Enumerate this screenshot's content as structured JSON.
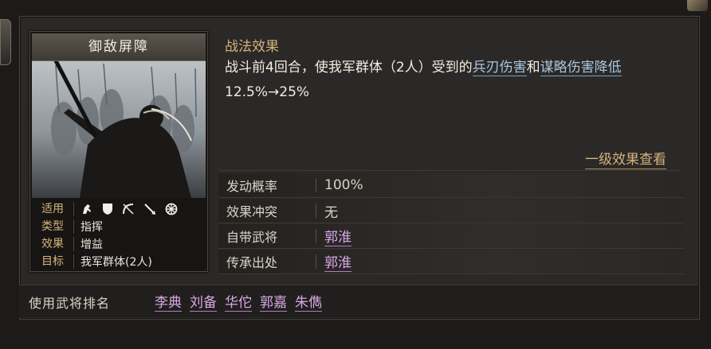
{
  "card": {
    "title": "御敌屏障",
    "info": [
      {
        "key": "适用",
        "value": ""
      },
      {
        "key": "类型",
        "value": "指挥"
      },
      {
        "key": "效果",
        "value": "增益"
      },
      {
        "key": "目标",
        "value": "我军群体(2人)"
      }
    ],
    "applicable_icons": [
      "cavalry-icon",
      "shield-icon",
      "bow-icon",
      "spear-icon",
      "wheel-icon"
    ]
  },
  "effect": {
    "section_title": "战法效果",
    "text_pre": "战斗前4回合，使我军群体（2人）受到的",
    "keyword1": "兵刃伤害",
    "text_mid": "和",
    "keyword2": "谋略伤害降低",
    "text_post": "12.5%→25%",
    "view_link": "一级效果查看"
  },
  "attributes": [
    {
      "key": "发动概率",
      "value": "100%"
    },
    {
      "key": "效果冲突",
      "value": "无"
    },
    {
      "key": "自带武将",
      "value": "郭淮"
    },
    {
      "key": "传承出处",
      "value": "郭淮"
    }
  ],
  "bottom": {
    "label": "使用武将排名",
    "generals": [
      "李典",
      "刘备",
      "华佗",
      "郭嘉",
      "朱儁"
    ]
  },
  "colors": {
    "gold": "#d4b27c",
    "keyword_blue": "#a9c7e0",
    "general_purple": "#d7a8e6"
  }
}
